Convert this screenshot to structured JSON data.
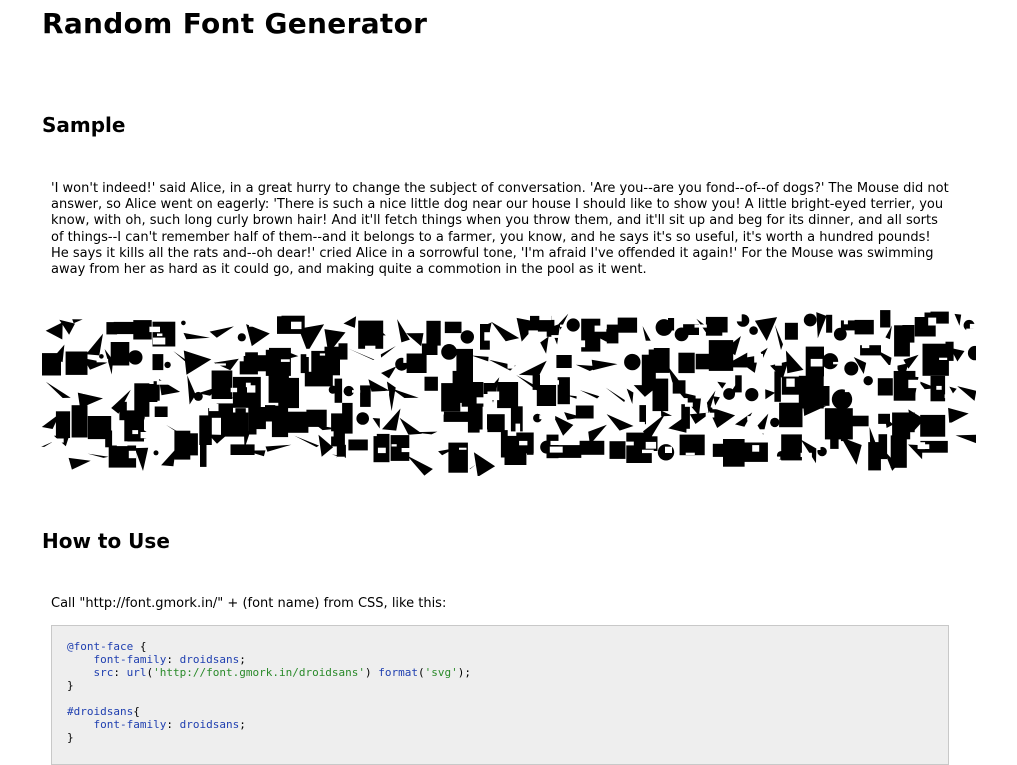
{
  "page": {
    "title": "Random Font Generator"
  },
  "sample": {
    "heading": "Sample",
    "text": "'I won't indeed!' said Alice, in a great hurry to change the subject of conversation. 'Are you--are you fond--of--of dogs?' The Mouse did not answer, so Alice went on eagerly: 'There is such a nice little dog near our house I should like to show you! A little bright-eyed terrier, you know, with oh, such long curly brown hair! And it'll fetch things when you throw them, and it'll sit up and beg for its dinner, and all sorts of things--I can't remember half of them--and it belongs to a farmer, you know, and he says it's so useful, it's worth a hundred pounds! He says it kills all the rats and--oh dear!' cried Alice in a sorrowful tone, 'I'm afraid I've offended it again!' For the Mouse was swimming away from her as hard as it could go, and making quite a commotion in the pool as it went."
  },
  "howto": {
    "heading": "How to Use",
    "intro": "Call \"http://font.gmork.in/\" + (font name) from CSS, like this:",
    "code": {
      "line1_selector": "@font-face",
      "line1_brace": " {",
      "line2_prop": "font-family",
      "line2_value": "droidsans",
      "line3_prop": "src",
      "line3_fn": "url",
      "line3_url": "'http://font.gmork.in/droidsans'",
      "line3_fn2": "format",
      "line3_fmt": "'svg'",
      "line4": "}",
      "line6_selector": "#droidsans",
      "line6_brace": "{",
      "line7_prop": "font-family",
      "line7_value": "droidsans",
      "line8": "}"
    }
  }
}
